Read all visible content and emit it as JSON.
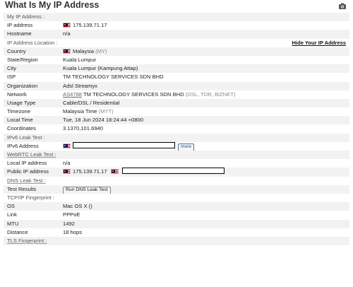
{
  "header": {
    "title": "What Is My IP Address",
    "camera_icon": "camera-icon"
  },
  "sections": {
    "my_ip": "My IP Address :",
    "location": "IP Address Location :",
    "hide_link": "Hide Your IP Address",
    "ipv6_leak": "IPv6 Leak Test :",
    "webrtc_leak": "WebRTC Leak Test :",
    "dns_leak": "DNS Leak Test :",
    "tcpip": "TCP/IP Fingerprint :",
    "tls": "TLS Fingerprint :"
  },
  "my_ip": {
    "ip_label": "IP address",
    "ip_value": "175.139.71.17",
    "hostname_label": "Hostname",
    "hostname_value": "n/a"
  },
  "location": {
    "country_label": "Country",
    "country_value": "Malaysia",
    "country_code": "(MY)",
    "state_label": "State/Region",
    "state_value": "Kuala Lumpur",
    "city_label": "City",
    "city_value": "Kuala Lumpur (Kampung Attap)",
    "isp_label": "ISP",
    "isp_value": "TM TECHNOLOGY SERVICES SDN BHD",
    "org_label": "Organization",
    "org_value": "Adsl Streamyx",
    "network_label": "Network",
    "network_as": "AS4788",
    "network_value": "TM TECHNOLOGY SERVICES SDN BHD",
    "network_extra": "(DSL, TDR, BIZNET)",
    "usage_label": "Usage Type",
    "usage_value": "Cable/DSL / Residential",
    "timezone_label": "Timezone",
    "timezone_value": "Malaysia Time",
    "timezone_code": "(MYT)",
    "localtime_label": "Local Time",
    "localtime_value": "Tue, 18 Jun 2024 18:24:44 +0800",
    "coords_label": "Coordinates",
    "coords_value": "3.1370,101.6940"
  },
  "ipv6": {
    "label": "IPv6 Address",
    "more_label": "more"
  },
  "webrtc": {
    "local_label": "Local IP address",
    "local_value": "n/a",
    "public_label": "Public IP address",
    "public_value": "175.139.71.17"
  },
  "dns": {
    "label": "Test Results",
    "button_label": "Run DNS Leak Test"
  },
  "tcpip": {
    "os_label": "OS",
    "os_value": "Mac OS X ()",
    "link_label": "Link",
    "link_value": "PPPoE",
    "mtu_label": "MTU",
    "mtu_value": "1492",
    "distance_label": "Distance",
    "distance_value": "18 hops"
  },
  "colors": {
    "flag_red": "#cc0001",
    "flag_blue": "#010066",
    "flag_yellow": "#ffcc00",
    "row_shade": "#f2f2f2"
  }
}
